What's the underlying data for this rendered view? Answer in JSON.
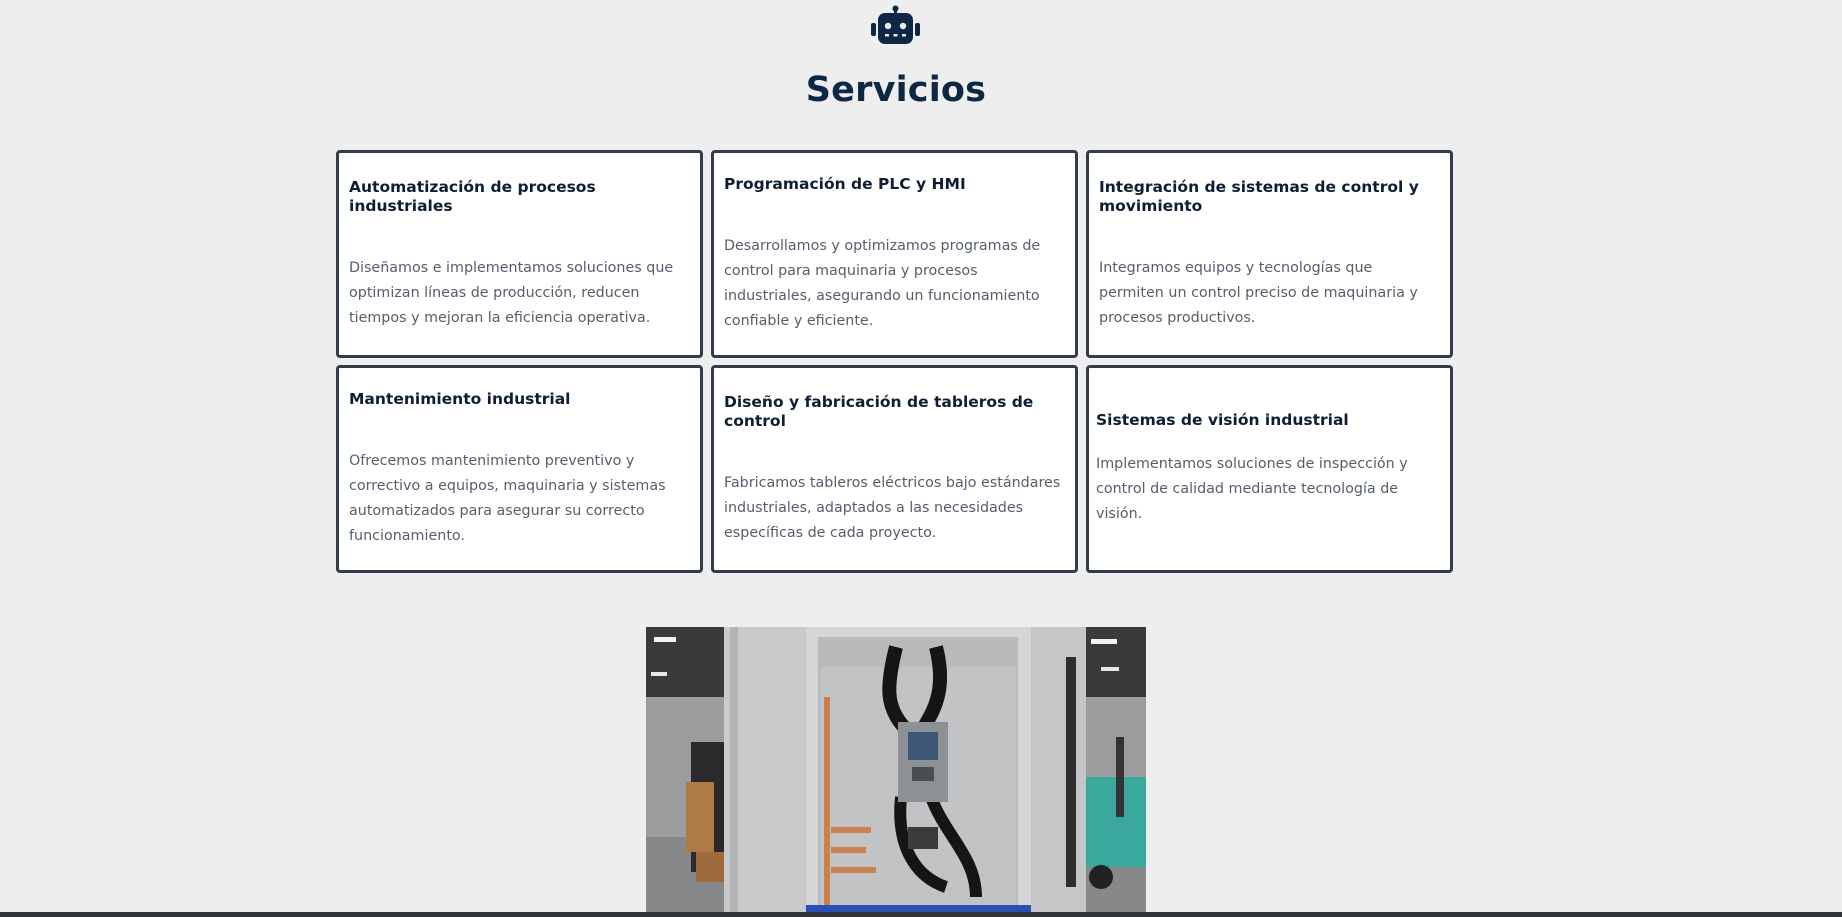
{
  "header": {
    "icon": "robot-icon",
    "title": "Servicios"
  },
  "services": [
    {
      "title": "Automatización de procesos industriales",
      "description": "Diseñamos e implementamos soluciones que optimizan líneas de producción, reducen tiempos y mejoran la eficiencia operativa."
    },
    {
      "title": "Programación de PLC y HMI",
      "description": "Desarrollamos y optimizamos programas de control para maquinaria y procesos industriales, asegurando un funcionamiento confiable y eficiente."
    },
    {
      "title": "Integración de sistemas de control y movimiento",
      "description": "Integramos equipos y tecnologías que permiten un control preciso de maquinaria y procesos productivos."
    },
    {
      "title": "Mantenimiento industrial",
      "description": "Ofrecemos mantenimiento preventivo y correctivo a equipos, maquinaria y sistemas automatizados para asegurar su correcto funcionamiento."
    },
    {
      "title": "Diseño y fabricación de tableros de control",
      "description": "Fabricamos tableros eléctricos bajo estándares industriales, adaptados a las necesidades específicas de cada proyecto."
    },
    {
      "title": "Sistemas de visión industrial",
      "description": "Implementamos soluciones de inspección y control de calidad mediante tecnología de visión."
    }
  ],
  "colors": {
    "background": "#eeeeee",
    "heading": "#0d2744",
    "card_border": "#333d49",
    "card_title": "#0f1e33",
    "card_text": "#555e6a"
  }
}
